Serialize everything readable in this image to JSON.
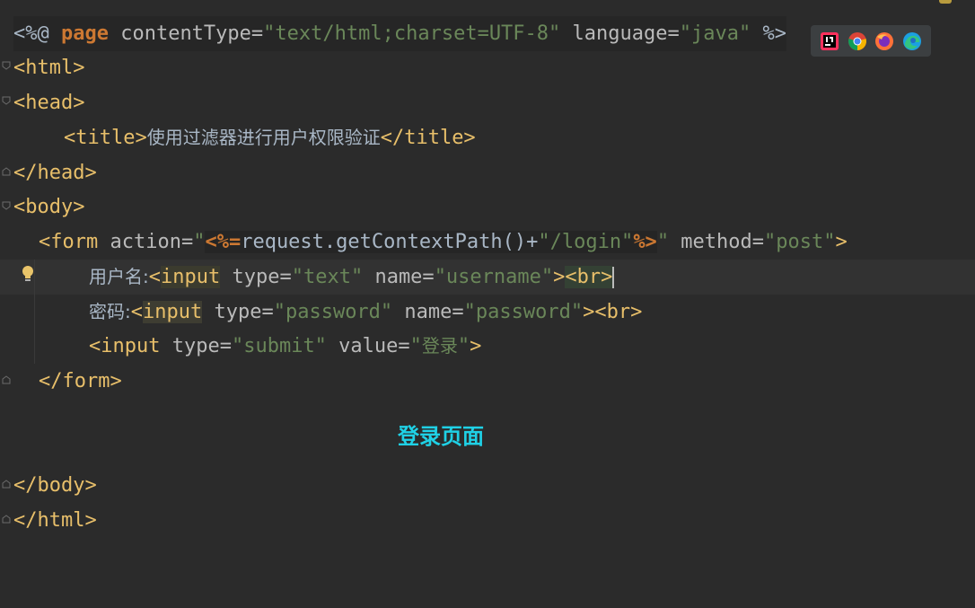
{
  "partial_top": "%>",
  "lines": {
    "l1": {
      "a": "<%@ ",
      "b": "page",
      "c": " contentType=",
      "d": "\"text/html;charset=UTF-8\"",
      "e": " language=",
      "f": "\"java\"",
      "g": " %>"
    },
    "l2": "<html>",
    "l3": "<head>",
    "l4": {
      "open": "<title>",
      "text": "使用过滤器进行用户权限验证",
      "close": "</title>"
    },
    "l5": "</head>",
    "l6": "<body>",
    "l7": {
      "a": "<form",
      "b": " action=",
      "c": "\"",
      "d": "<%=",
      "e": "request.getContextPath()+",
      "f": "\"/login\"",
      "g": "%>",
      "h": "\"",
      "i": " method=",
      "j": "\"post\"",
      "k": ">"
    },
    "l8": {
      "label": "用户名:",
      "lt": "<",
      "tag": "input",
      "t1": " type=",
      "v1": "\"text\"",
      "t2": " name=",
      "v2": "\"username\"",
      "gt": ">",
      "br": "<br>"
    },
    "l9": {
      "label": "密码:",
      "lt": "<",
      "tag": "input",
      "t1": " type=",
      "v1": "\"password\"",
      "t2": " name=",
      "v2": "\"password\"",
      "gt": ">",
      "br": "<br>"
    },
    "l10": {
      "open": "<input",
      "t1": " type=",
      "v1": "\"submit\"",
      "t2": " value=",
      "v2a": "\"",
      "v2b": "登录",
      "v2c": "\"",
      "gt": ">"
    },
    "l11": "</form>",
    "l12": "</body>",
    "l13": "</html>"
  },
  "rendered_preview": "登录页面",
  "browsers": [
    "intellij-icon",
    "chrome-icon",
    "firefox-icon",
    "edge-icon"
  ]
}
